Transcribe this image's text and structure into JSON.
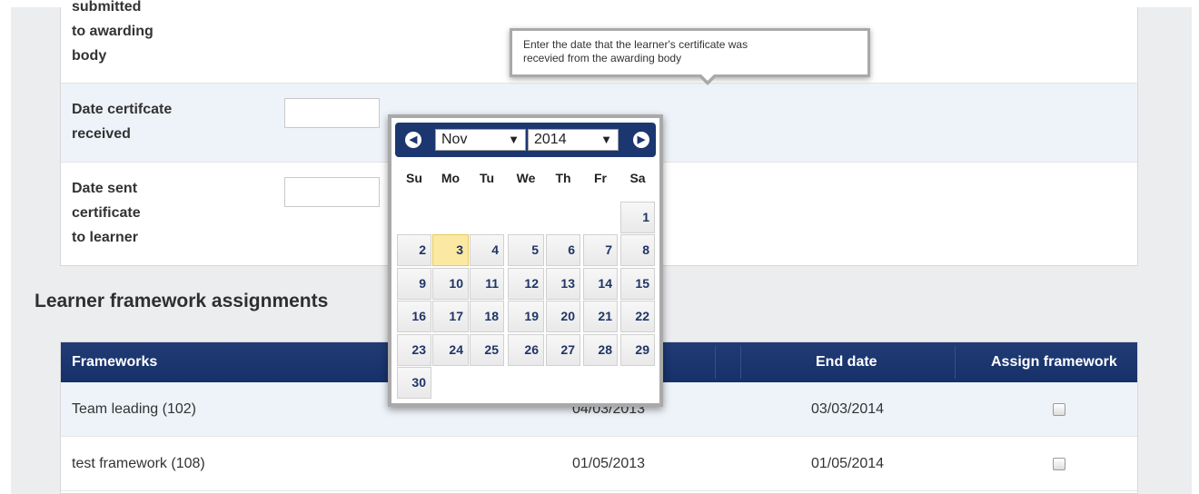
{
  "form": {
    "row1_label_lines": [
      "submitted",
      "to awarding",
      "body"
    ],
    "row2_label_lines": [
      "Date certifcate",
      "received"
    ],
    "row3_label_lines": [
      "Date sent",
      "certificate",
      "to learner"
    ]
  },
  "tooltip": {
    "text_line1": "Enter the date that the learner's certificate was",
    "text_line2": "recevied from the awarding body"
  },
  "calendar": {
    "month": "Nov",
    "year": "2014",
    "prev_icon": "chevron-left-icon",
    "next_icon": "chevron-right-icon",
    "weekdays": [
      "Su",
      "Mo",
      "Tu",
      "We",
      "Th",
      "Fr",
      "Sa"
    ],
    "first_weekday_index": 6,
    "days": [
      "1",
      "2",
      "3",
      "4",
      "5",
      "6",
      "7",
      "8",
      "9",
      "10",
      "11",
      "12",
      "13",
      "14",
      "15",
      "16",
      "17",
      "18",
      "19",
      "20",
      "21",
      "22",
      "23",
      "24",
      "25",
      "26",
      "27",
      "28",
      "29",
      "30"
    ],
    "highlighted_day": "3"
  },
  "section": {
    "title": "Learner framework assignments"
  },
  "grid": {
    "headers": {
      "frameworks": "Frameworks",
      "end_date": "End date",
      "assign": "Assign framework"
    },
    "rows": [
      {
        "framework": "Team leading (102)",
        "start_date": "04/03/2013",
        "end_date": "03/03/2014",
        "assigned": false
      },
      {
        "framework": "test framework (108)",
        "start_date": "01/05/2013",
        "end_date": "01/05/2014",
        "assigned": false
      }
    ]
  }
}
